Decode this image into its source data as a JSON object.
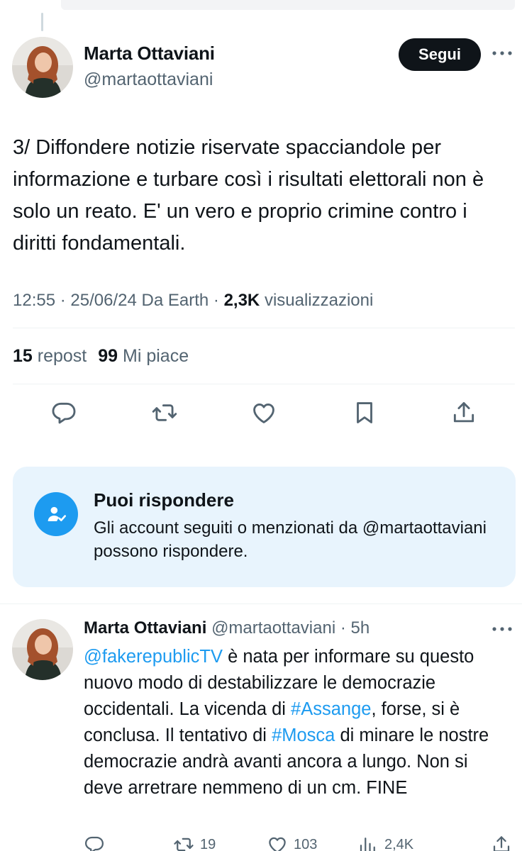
{
  "main_tweet": {
    "author_name": "Marta Ottaviani",
    "author_handle": "@martaottaviani",
    "follow_label": "Segui",
    "text": "3/ Diffondere notizie riservate spacciandole per informazione e turbare così i risultati elettorali non è solo un reato. E' un vero e proprio crimine contro i diritti fondamentali.",
    "time": "12:55",
    "date": "25/06/24",
    "source": "Da Earth",
    "views_count": "2,3K",
    "views_label": "visualizzazioni",
    "reposts_count": "15",
    "reposts_label": "repost",
    "likes_count": "99",
    "likes_label": "Mi piace"
  },
  "reply_notice": {
    "title": "Puoi rispondere",
    "body": "Gli account seguiti o menzionati da @martaottaviani possono rispondere."
  },
  "reply_tweet": {
    "author_name": "Marta Ottaviani",
    "author_handle": "@martaottaviani",
    "time_ago": "5h",
    "segments": {
      "mention": "@fakerepublicTV",
      "t1": " è nata per informare su questo nuovo modo di destabilizzare le democrazie occidentali. La vicenda di ",
      "hashtag1": "#Assange",
      "t2": ", forse, si è conclusa. Il tentativo di ",
      "hashtag2": "#Mosca",
      "t3": " di minare le nostre democrazie andrà avanti ancora a lungo. Non si deve arretrare nemmeno di un cm. FINE"
    },
    "reposts": "19",
    "likes": "103",
    "views": "2,4K"
  },
  "colors": {
    "accent": "#1d9bf0",
    "text_primary": "#0f1419",
    "text_secondary": "#536471",
    "notice_bg": "#e8f4fd"
  },
  "icons": [
    "reply-icon",
    "repost-icon",
    "like-icon",
    "bookmark-icon",
    "share-icon",
    "more-icon",
    "person-check-icon",
    "views-icon"
  ]
}
